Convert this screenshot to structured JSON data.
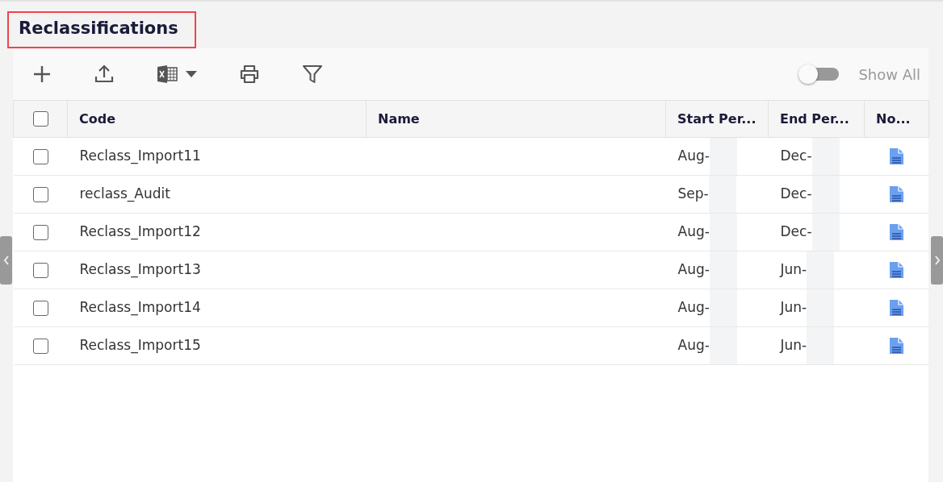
{
  "title": "Reclassifications",
  "toolbar": {
    "show_all": {
      "label": "Show All",
      "on": false
    }
  },
  "table": {
    "select_all": {
      "checked": false
    },
    "columns": [
      "Code",
      "Name",
      "Start Per...",
      "End Per...",
      "No..."
    ],
    "rows": [
      {
        "checked": false,
        "code": "Reclass_Import11",
        "start": "Aug-",
        "end": "Dec-"
      },
      {
        "checked": false,
        "code": "reclass_Audit",
        "start": "Sep-",
        "end": "Dec-"
      },
      {
        "checked": false,
        "code": "Reclass_Import12",
        "start": "Aug-",
        "end": "Dec-"
      },
      {
        "checked": false,
        "code": "Reclass_Import13",
        "start": "Aug-",
        "end": "Jun-"
      },
      {
        "checked": false,
        "code": "Reclass_Import14",
        "start": "Aug-",
        "end": "Jun-"
      },
      {
        "checked": false,
        "code": "Reclass_Import15",
        "start": "Aug-",
        "end": "Jun-"
      }
    ]
  }
}
